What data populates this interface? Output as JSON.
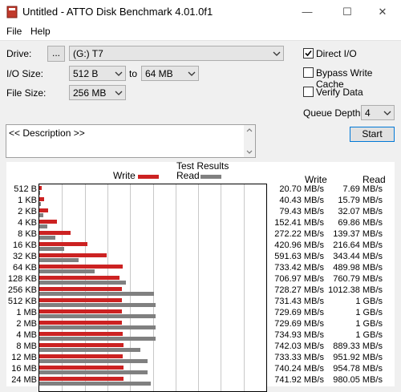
{
  "window": {
    "title": "Untitled - ATTO Disk Benchmark 4.01.0f1",
    "minimize": "—",
    "maximize": "☐",
    "close": "✕"
  },
  "menu": {
    "file": "File",
    "help": "Help"
  },
  "controls": {
    "drive_label": "Drive:",
    "drive_browse": "...",
    "drive_value": "(G:) T7",
    "io_size_label": "I/O Size:",
    "io_from": "512 B",
    "io_to_label": "to",
    "io_to": "64 MB",
    "file_size_label": "File Size:",
    "file_size": "256 MB",
    "direct_io_label": "Direct I/O",
    "direct_io_checked": true,
    "bypass_write_cache_label": "Bypass Write Cache",
    "bypass_write_cache_checked": false,
    "verify_data_label": "Verify Data",
    "verify_data_checked": false,
    "queue_depth_label": "Queue Depth:",
    "queue_depth": "4",
    "start_label": "Start",
    "description": "<< Description >>"
  },
  "chart_data": {
    "type": "bar",
    "title": "Test Results",
    "legend": [
      "Write",
      "Read"
    ],
    "colors": {
      "write": "#cc2222",
      "read": "#808080"
    },
    "categories": [
      "512 B",
      "1 KB",
      "2 KB",
      "4 KB",
      "8 KB",
      "16 KB",
      "32 KB",
      "64 KB",
      "128 KB",
      "256 KB",
      "512 KB",
      "1 MB",
      "2 MB",
      "4 MB",
      "8 MB",
      "12 MB",
      "16 MB",
      "24 MB"
    ],
    "series": [
      {
        "name": "Write",
        "values_mbps": [
          20.7,
          40.43,
          79.43,
          152.41,
          272.22,
          420.96,
          591.63,
          733.42,
          706.97,
          728.27,
          731.43,
          729.69,
          729.69,
          734.93,
          742.03,
          733.33,
          740.24,
          741.92
        ]
      },
      {
        "name": "Read",
        "values_mbps": [
          7.69,
          15.79,
          32.07,
          69.86,
          139.37,
          216.64,
          343.44,
          489.98,
          760.79,
          1012.38,
          1024,
          1024,
          1024,
          1024,
          889.33,
          951.92,
          954.78,
          980.05
        ]
      }
    ],
    "write_labels": [
      "20.70 MB/s",
      "40.43 MB/s",
      "79.43 MB/s",
      "152.41 MB/s",
      "272.22 MB/s",
      "420.96 MB/s",
      "591.63 MB/s",
      "733.42 MB/s",
      "706.97 MB/s",
      "728.27 MB/s",
      "731.43 MB/s",
      "729.69 MB/s",
      "729.69 MB/s",
      "734.93 MB/s",
      "742.03 MB/s",
      "733.33 MB/s",
      "740.24 MB/s",
      "741.92 MB/s"
    ],
    "read_labels": [
      "7.69 MB/s",
      "15.79 MB/s",
      "32.07 MB/s",
      "69.86 MB/s",
      "139.37 MB/s",
      "216.64 MB/s",
      "343.44 MB/s",
      "489.98 MB/s",
      "760.79 MB/s",
      "1012.38 MB/s",
      "1 GB/s",
      "1 GB/s",
      "1 GB/s",
      "1 GB/s",
      "889.33 MB/s",
      "951.92 MB/s",
      "954.78 MB/s",
      "980.05 MB/s"
    ],
    "write_header": "Write",
    "read_header": "Read",
    "x_max_mbps": 2000,
    "grid": true
  }
}
